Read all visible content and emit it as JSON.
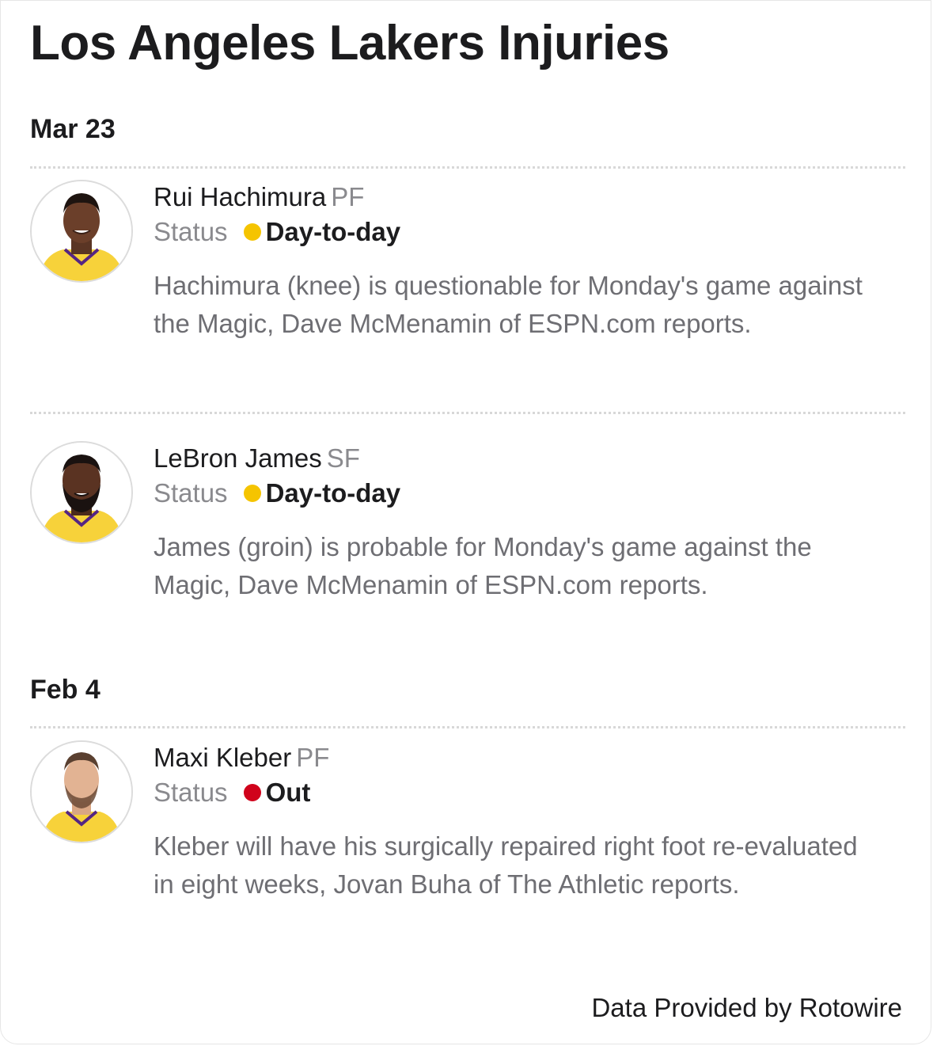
{
  "title": "Los Angeles Lakers Injuries",
  "sections": [
    {
      "date": "Mar 23",
      "entries": [
        {
          "name": "Rui Hachimura",
          "position": "PF",
          "status_label": "Status",
          "status": "Day-to-day",
          "status_color": "#f5c400",
          "description": "Hachimura (knee) is questionable for Monday's game against the Magic, Dave McMenamin of ESPN.com reports."
        },
        {
          "name": "LeBron James",
          "position": "SF",
          "status_label": "Status",
          "status": "Day-to-day",
          "status_color": "#f5c400",
          "description": "James (groin) is probable for Monday's game against the Magic, Dave McMenamin of ESPN.com reports."
        }
      ]
    },
    {
      "date": "Feb 4",
      "entries": [
        {
          "name": "Maxi Kleber",
          "position": "PF",
          "status_label": "Status",
          "status": "Out",
          "status_color": "#d0021b",
          "description": "Kleber will have his surgically repaired right foot re-evaluated in eight weeks, Jovan Buha of The Athletic reports."
        }
      ]
    }
  ],
  "footer": "Data Provided by Rotowire",
  "colors": {
    "jersey_yellow": "#f7d23a",
    "jersey_purple": "#552583",
    "text_primary": "#1c1c1e",
    "text_secondary": "#6e6e73"
  }
}
